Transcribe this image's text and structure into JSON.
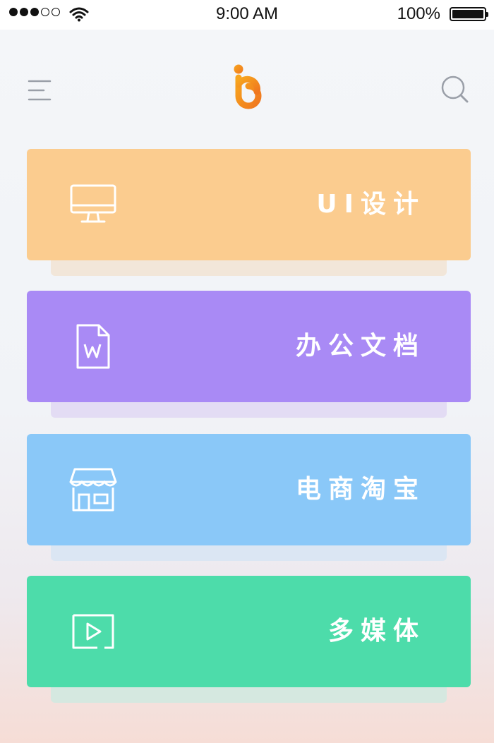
{
  "status_bar": {
    "time": "9:00 AM",
    "battery": "100%",
    "signal_dots_filled": 3,
    "signal_dots_total": 5
  },
  "header": {
    "menu_icon": "hamburger-menu-icon",
    "logo_icon": "ib-logo-icon",
    "search_icon": "search-icon"
  },
  "cards": [
    {
      "label": "UI设计",
      "icon": "monitor-icon",
      "color": "#fbcc8f",
      "shadow": "#f2e6d9"
    },
    {
      "label": "办公文档",
      "icon": "word-document-icon",
      "color": "#a98af5",
      "shadow": "#e3dcf4"
    },
    {
      "label": "电商淘宝",
      "icon": "storefront-icon",
      "color": "#8ac8f8",
      "shadow": "#dbe6f3"
    },
    {
      "label": "多媒体",
      "icon": "video-play-icon",
      "color": "#4ddcaa",
      "shadow": "#d5e8e0"
    }
  ]
}
